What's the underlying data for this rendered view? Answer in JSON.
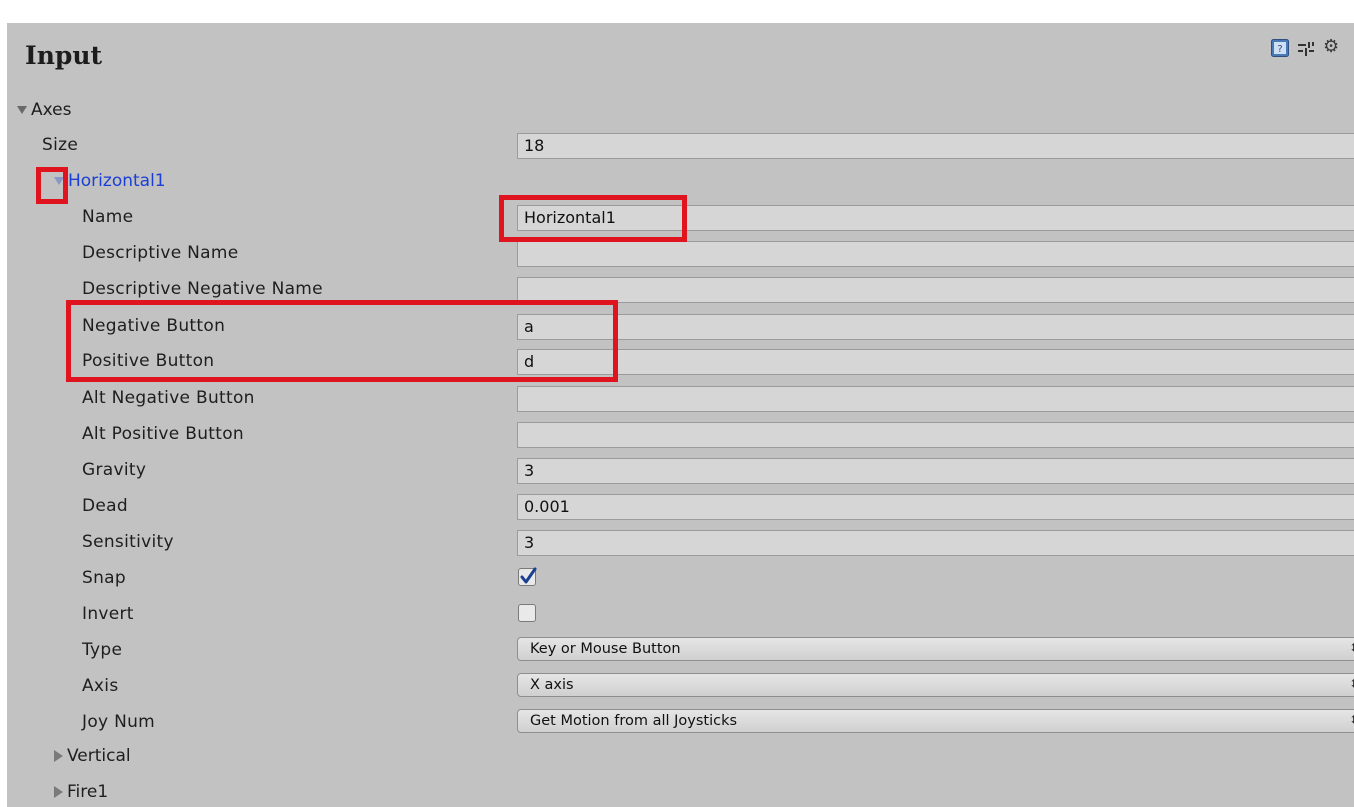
{
  "panel": {
    "title": "Input"
  },
  "header_icons": [
    "help-icon",
    "presets-icon",
    "gear-icon"
  ],
  "gear_glyph": "⚙",
  "axes": {
    "label": "Axes",
    "size_label": "Size",
    "size_value": "18",
    "expanded_axis": {
      "name": "Horizontal1",
      "properties": {
        "name": {
          "label": "Name",
          "value": "Horizontal1"
        },
        "descriptive_name": {
          "label": "Descriptive Name",
          "value": ""
        },
        "descriptive_negative_name": {
          "label": "Descriptive Negative Name",
          "value": ""
        },
        "negative_button": {
          "label": "Negative Button",
          "value": "a"
        },
        "positive_button": {
          "label": "Positive Button",
          "value": "d"
        },
        "alt_negative_button": {
          "label": "Alt Negative Button",
          "value": ""
        },
        "alt_positive_button": {
          "label": "Alt Positive Button",
          "value": ""
        },
        "gravity": {
          "label": "Gravity",
          "value": "3"
        },
        "dead": {
          "label": "Dead",
          "value": "0.001"
        },
        "sensitivity": {
          "label": "Sensitivity",
          "value": "3"
        },
        "snap": {
          "label": "Snap",
          "checked": true
        },
        "invert": {
          "label": "Invert",
          "checked": false
        },
        "type": {
          "label": "Type",
          "value": "Key or Mouse Button"
        },
        "axis": {
          "label": "Axis",
          "value": "X axis"
        },
        "joy_num": {
          "label": "Joy Num",
          "value": "Get Motion from all Joysticks"
        }
      }
    },
    "collapsed_axes": [
      "Vertical",
      "Fire1"
    ]
  },
  "popup_arrow_glyph": "⬍",
  "highlight_color": "#e0141e",
  "link_color": "#1a3fd6"
}
